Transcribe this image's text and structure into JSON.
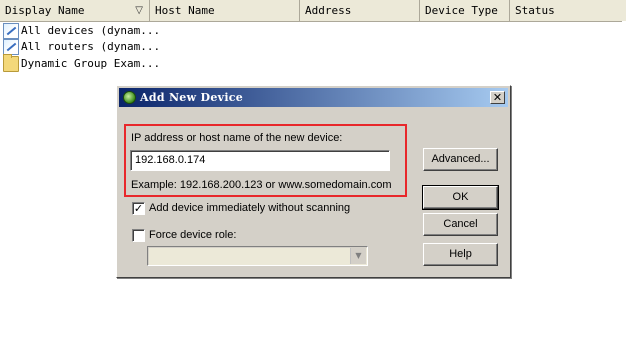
{
  "list": {
    "columns": [
      "Display Name",
      "Host Name",
      "Address",
      "Device Type",
      "Status"
    ],
    "sort_indicator": "▽",
    "rows": [
      {
        "label": "All devices (dynam...",
        "icon": "dynamic-group-icon"
      },
      {
        "label": "All routers (dynam...",
        "icon": "dynamic-group-icon"
      },
      {
        "label": "Dynamic Group Exam...",
        "icon": "folder-icon"
      }
    ]
  },
  "dialog": {
    "title": "Add New Device",
    "close_glyph": "✕",
    "ip_label": "IP address or host name of the new device:",
    "ip_value": "192.168.0.174",
    "example": "Example: 192.168.200.123 or www.somedomain.com",
    "add_immediately_label": "Add device immediately without scanning",
    "add_immediately_checked": true,
    "check_glyph": "✓",
    "force_role_label": "Force device role:",
    "force_role_checked": false,
    "force_role_value": "",
    "combo_arrow": "▼",
    "buttons": {
      "advanced": "Advanced...",
      "ok": "OK",
      "cancel": "Cancel",
      "help": "Help"
    },
    "highlight_color": "#e8272b"
  }
}
